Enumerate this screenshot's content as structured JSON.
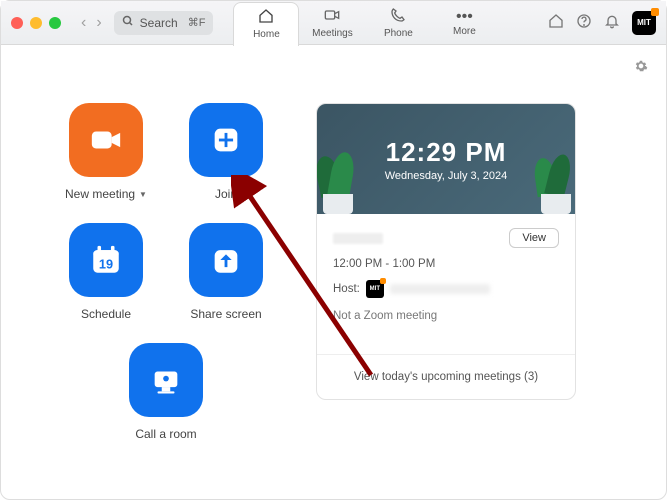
{
  "titlebar": {
    "search_placeholder": "Search",
    "shortcut": "⌘F",
    "tabs": [
      {
        "icon": "home",
        "label": "Home"
      },
      {
        "icon": "video",
        "label": "Meetings"
      },
      {
        "icon": "phone",
        "label": "Phone"
      },
      {
        "icon": "more",
        "label": "More"
      }
    ],
    "avatar_text": "MIT"
  },
  "actions": {
    "new_meeting": "New meeting",
    "join": "Join",
    "schedule": "Schedule",
    "schedule_day": "19",
    "share_screen": "Share screen",
    "call_room": "Call a room"
  },
  "clock": {
    "time": "12:29 PM",
    "date": "Wednesday, July 3, 2024"
  },
  "event": {
    "view_label": "View",
    "time_range": "12:00 PM - 1:00 PM",
    "host_label": "Host:",
    "host_avatar_text": "MIT",
    "not_zoom": "Not a Zoom meeting",
    "footer": "View today's upcoming meetings (3)"
  }
}
